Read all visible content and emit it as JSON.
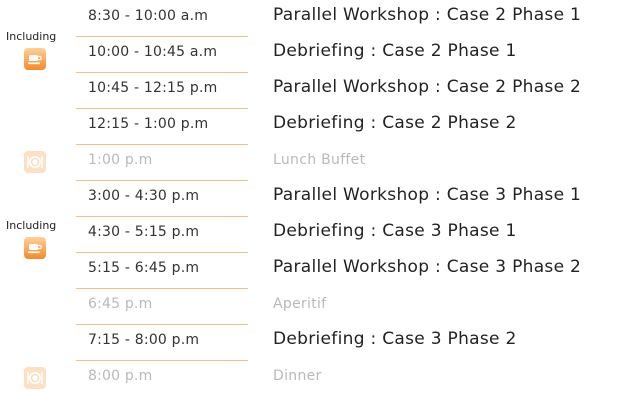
{
  "including_label": "Including",
  "icons": {
    "coffee": "coffee-cup-icon",
    "meal": "plate-cutlery-icon"
  },
  "colors": {
    "accent": "#f38a2c",
    "rule": "#f2c08a",
    "muted_text": "#b9b9b9"
  },
  "schedule": [
    {
      "time": "8:30 - 10:00 a.m",
      "event": "Parallel Workshop : Case 2 Phase 1"
    },
    {
      "time": "10:00 - 10:45 a.m",
      "event": "Debriefing : Case 2 Phase 1"
    },
    {
      "time": "10:45 - 12:15 p.m",
      "event": "Parallel Workshop : Case 2 Phase 2"
    },
    {
      "time": "12:15 - 1:00 p.m",
      "event": "Debriefing : Case 2 Phase 2"
    },
    {
      "time": "1:00 p.m",
      "event": "Lunch Buffet"
    },
    {
      "time": "3:00 - 4:30 p.m",
      "event": "Parallel Workshop : Case 3 Phase 1"
    },
    {
      "time": "4:30 - 5:15 p.m",
      "event": "Debriefing : Case 3 Phase 1"
    },
    {
      "time": "5:15 - 6:45 p.m",
      "event": "Parallel Workshop : Case 3 Phase 2"
    },
    {
      "time": "6:45 p.m",
      "event": "Aperitif"
    },
    {
      "time": "7:15 - 8:00 p.m",
      "event": "Debriefing : Case 3 Phase 2"
    },
    {
      "time": "8:00 p.m",
      "event": "Dinner"
    }
  ]
}
